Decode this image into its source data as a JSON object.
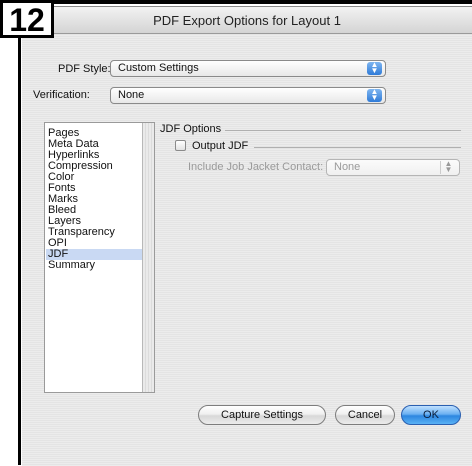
{
  "step": {
    "number": "12"
  },
  "window": {
    "title": "PDF Export Options for Layout 1"
  },
  "pdf_style": {
    "label": "PDF Style:",
    "value": "Custom Settings"
  },
  "verification": {
    "label": "Verification:",
    "value": "None"
  },
  "sidebar": {
    "items": [
      {
        "label": "Pages"
      },
      {
        "label": "Meta Data"
      },
      {
        "label": "Hyperlinks"
      },
      {
        "label": "Compression"
      },
      {
        "label": "Color"
      },
      {
        "label": "Fonts"
      },
      {
        "label": "Marks"
      },
      {
        "label": "Bleed"
      },
      {
        "label": "Layers"
      },
      {
        "label": "Transparency"
      },
      {
        "label": "OPI"
      },
      {
        "label": "JDF"
      },
      {
        "label": "Summary"
      }
    ],
    "selected": "JDF"
  },
  "jdf_options": {
    "title": "JDF Options",
    "output_jdf": {
      "label": "Output JDF",
      "checked": false
    },
    "job_jacket": {
      "label": "Include Job Jacket Contact:",
      "value": "None"
    }
  },
  "buttons": {
    "capture": "Capture Settings",
    "cancel": "Cancel",
    "ok": "OK"
  },
  "colors": {
    "accent": "#2d86e0",
    "selection": "#c9d9f3"
  }
}
